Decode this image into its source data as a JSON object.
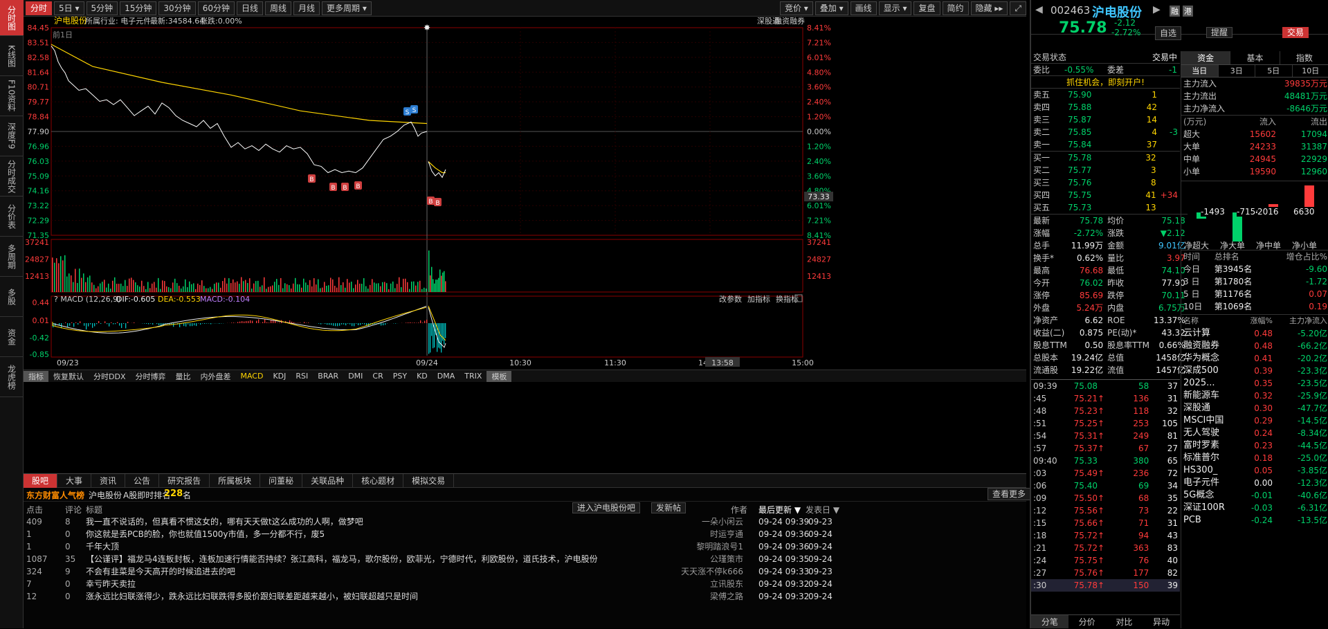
{
  "left_nav": [
    "分时图",
    "K线图",
    "F10资料",
    "深度F9",
    "分时成交",
    "分价表",
    "多周期",
    "多股",
    "资金",
    "龙虎榜"
  ],
  "periods": [
    "分时",
    "5日",
    "5分钟",
    "15分钟",
    "30分钟",
    "60分钟",
    "日线",
    "周线",
    "月线",
    "更多周期"
  ],
  "toolbar_right": [
    "竞价",
    "叠加",
    "画线",
    "显示",
    "复盘",
    "简约",
    "隐藏"
  ],
  "chart_header": {
    "name": "沪电股份",
    "industry": "所属行业: 电子元件",
    "latest": "最新:34584.64",
    "change": "涨跌:0.00%",
    "links": [
      "深股通",
      "融资融券"
    ],
    "prev_day": "前1日"
  },
  "price_ticks": [
    "84.45",
    "83.51",
    "82.58",
    "81.64",
    "80.71",
    "79.77",
    "78.84",
    "77.90",
    "76.96",
    "76.03",
    "75.09",
    "74.16",
    "73.22",
    "72.29",
    "71.35"
  ],
  "pct_ticks": [
    "8.41%",
    "7.21%",
    "6.01%",
    "4.80%",
    "3.60%",
    "2.40%",
    "1.20%",
    "0.00%",
    "1.20%",
    "2.40%",
    "3.60%",
    "4.80%",
    "6.01%",
    "7.21%",
    "8.41%"
  ],
  "cursor_price": "73.33",
  "vol_ticks": [
    "37241",
    "24827",
    "12413"
  ],
  "macd": {
    "label": "MACD (12,26,9)",
    "dif": "DIF:-0.605",
    "dea": "DEA:-0.553",
    "macd": "MACD:-0.104",
    "ticks": [
      "0.44",
      "0.01",
      "-0.42",
      "-0.85"
    ],
    "btns": [
      "改参数",
      "加指标",
      "换指标"
    ]
  },
  "time_axis": [
    "09/23",
    "09/24",
    "10:30",
    "11:30",
    "14",
    "13:58",
    "15:00"
  ],
  "indicators": [
    "指标",
    "恢复默认",
    "分时DDX",
    "分时博弈",
    "量比",
    "内外盘差",
    "MACD",
    "KDJ",
    "RSI",
    "BRAR",
    "DMI",
    "CR",
    "PSY",
    "KD",
    "DMA",
    "TRIX",
    "模板"
  ],
  "bottom": {
    "tabs": [
      "股吧",
      "大事",
      "资讯",
      "公告",
      "研究报告",
      "所属板块",
      "问董秘",
      "关联品种",
      "核心题材",
      "模拟交易"
    ],
    "rank_title": "东方财富人气榜",
    "rank_stock": "沪电股份",
    "rank_label": "A股即时排名",
    "rank_num": "228",
    "rank_unit": "名",
    "more": "查看更多",
    "headers": [
      "点击",
      "评论",
      "标题",
      "作者",
      "最后更新",
      "发表日"
    ],
    "enter_btn": "进入沪电股份吧",
    "post_btn": "发新帖",
    "posts": [
      {
        "clicks": "409",
        "comments": "8",
        "title": "我一直不说话的，但真看不惯这女的，哪有天天做t这么成功的人啊，做梦吧",
        "author": "一朵小闲云",
        "updated": "09-24 09:39",
        "date": "09-23"
      },
      {
        "clicks": "1",
        "comments": "0",
        "title": "你这就是丢PCB的脸，你也就值1500y市值，多一分都不行，废5",
        "author": "时运亨通",
        "updated": "09-24 09:36",
        "date": "09-24"
      },
      {
        "clicks": "1",
        "comments": "0",
        "title": "千年大顶",
        "author": "黎明踏浪号1",
        "updated": "09-24 09:36",
        "date": "09-24"
      },
      {
        "clicks": "1087",
        "comments": "35",
        "title": "【公谨评】福龙马4连板封板，连板加速行情能否持续？张江高科，福龙马，歌尔股份，欧菲光，宁德时代，利欧股份，道氏技术，沪电股份",
        "author": "公瑾策市",
        "updated": "09-24 09:35",
        "date": "09-24"
      },
      {
        "clicks": "324",
        "comments": "9",
        "title": "不会有韭菜是今天高开的时候追进去的吧",
        "author": "天天涨不停k666",
        "updated": "09-24 09:33",
        "date": "09-23"
      },
      {
        "clicks": "7",
        "comments": "0",
        "title": "幸亏昨天卖拉",
        "author": "立讯股东",
        "updated": "09-24 09:32",
        "date": "09-24"
      },
      {
        "clicks": "12",
        "comments": "0",
        "title": "涨永远比妇联涨得少，跌永远比妇联跌得多股价跟妇联差距越来越小，被妇联超越只是时间",
        "author": "梁傅之路",
        "updated": "09-24 09:32",
        "date": "09-24"
      }
    ]
  },
  "quote": {
    "code": "002463",
    "name": "沪电股份",
    "icons": [
      "融",
      "港"
    ],
    "price": "75.78",
    "chg": "-2.12",
    "pct": "-2.72%",
    "btns": [
      "自选",
      "提醒",
      "交易"
    ],
    "status_label": "交易状态",
    "status": "交易中",
    "webi_label": "委比",
    "webi": "-0.55%",
    "weicha_label": "委差",
    "weicha": "-1",
    "ad": "抓住机会，即刻开户!",
    "asks": [
      [
        "卖五",
        "75.90",
        "1",
        ""
      ],
      [
        "卖四",
        "75.88",
        "42",
        ""
      ],
      [
        "卖三",
        "75.87",
        "14",
        ""
      ],
      [
        "卖二",
        "75.85",
        "4",
        "-3"
      ],
      [
        "卖一",
        "75.84",
        "37",
        ""
      ]
    ],
    "bids": [
      [
        "买一",
        "75.78",
        "32",
        ""
      ],
      [
        "买二",
        "75.77",
        "3",
        ""
      ],
      [
        "买三",
        "75.76",
        "8",
        ""
      ],
      [
        "买四",
        "75.75",
        "41",
        "+34"
      ],
      [
        "买五",
        "75.73",
        "13",
        ""
      ]
    ],
    "stats": [
      [
        "最新",
        "75.78",
        "均价",
        "75.18"
      ],
      [
        "涨幅",
        "-2.72%",
        "涨跌",
        "▼2.12"
      ],
      [
        "总手",
        "11.99万",
        "金额",
        "9.01亿"
      ],
      [
        "换手*",
        "0.62%",
        "量比",
        "3.97"
      ],
      [
        "最高",
        "76.68",
        "最低",
        "74.10"
      ],
      [
        "今开",
        "76.02",
        "昨收",
        "77.90"
      ],
      [
        "涨停",
        "85.69",
        "跌停",
        "70.11"
      ],
      [
        "外盘",
        "5.24万",
        "内盘",
        "6.75万"
      ],
      [
        "净资产",
        "6.62",
        "ROE",
        "13.37%"
      ],
      [
        "收益(二)",
        "0.875",
        "PE(动)*",
        "43.32"
      ],
      [
        "股息TTM",
        "0.50",
        "股息率TTM",
        "0.66%"
      ],
      [
        "总股本",
        "19.24亿",
        "总值",
        "1458亿"
      ],
      [
        "流通股",
        "19.22亿",
        "流值",
        "1457亿"
      ]
    ],
    "ticks": [
      [
        "09:39",
        "75.08",
        "58",
        "37",
        "g"
      ],
      [
        ":45",
        "75.21",
        "136",
        "31",
        "r"
      ],
      [
        ":48",
        "75.23",
        "118",
        "32",
        "r"
      ],
      [
        ":51",
        "75.25",
        "253",
        "105",
        "r"
      ],
      [
        ":54",
        "75.31",
        "249",
        "81",
        "r"
      ],
      [
        ":57",
        "75.37",
        "67",
        "27",
        "r"
      ],
      [
        "09:40",
        "75.33",
        "380",
        "65",
        "g"
      ],
      [
        ":03",
        "75.49",
        "236",
        "72",
        "r"
      ],
      [
        ":06",
        "75.40",
        "69",
        "34",
        "g"
      ],
      [
        ":09",
        "75.50",
        "68",
        "35",
        "r"
      ],
      [
        ":12",
        "75.56",
        "73",
        "22",
        "r"
      ],
      [
        ":15",
        "75.66",
        "71",
        "31",
        "r"
      ],
      [
        ":18",
        "75.72",
        "94",
        "43",
        "r"
      ],
      [
        ":21",
        "75.72",
        "363",
        "83",
        "r"
      ],
      [
        ":24",
        "75.75",
        "76",
        "40",
        "r"
      ],
      [
        ":27",
        "75.76",
        "177",
        "82",
        "r"
      ],
      [
        ":30",
        "75.78",
        "150",
        "39",
        "r"
      ]
    ],
    "bottom_tabs": [
      "分笔",
      "分价",
      "对比",
      "异动"
    ]
  },
  "funds": {
    "tabs": [
      "资金",
      "基本",
      "指数"
    ],
    "periods": [
      "当日",
      "3日",
      "5日",
      "10日"
    ],
    "flows": [
      [
        "主力流入",
        "39835万元",
        "r"
      ],
      [
        "主力流出",
        "48481万元",
        "g"
      ],
      [
        "主力净流入",
        "-8646万元",
        "g"
      ]
    ],
    "unit": "(万元)",
    "in_label": "流入",
    "out_label": "流出",
    "sizes": [
      [
        "超大",
        "15602",
        "17094"
      ],
      [
        "大单",
        "24233",
        "31387"
      ],
      [
        "中单",
        "24945",
        "22929"
      ],
      [
        "小单",
        "19590",
        "12960"
      ]
    ],
    "bars": [
      {
        "label": "净超大",
        "value": -1493
      },
      {
        "label": "净大单",
        "value": -7154
      },
      {
        "label": "净中单",
        "value": 2016
      },
      {
        "label": "净小单",
        "value": 6630
      }
    ],
    "rank_head": [
      "时间",
      "总排名",
      "增仓占比%"
    ],
    "ranks": [
      [
        "今日",
        "第3945名",
        "-9.60",
        "g"
      ],
      [
        "3 日",
        "第1780名",
        "-1.72",
        "g"
      ],
      [
        "5 日",
        "第1176名",
        "0.07",
        "r"
      ],
      [
        "10日",
        "第1069名",
        "0.19",
        "r"
      ]
    ],
    "sector_head": [
      "名称",
      "涨幅%",
      "主力净流入"
    ],
    "sectors": [
      [
        "云计算",
        "0.48",
        "-5.20亿"
      ],
      [
        "融资融券",
        "0.48",
        "-66.2亿"
      ],
      [
        "华为概念",
        "0.41",
        "-20.2亿"
      ],
      [
        "深成500",
        "0.39",
        "-23.3亿"
      ],
      [
        "2025...",
        "0.35",
        "-23.5亿"
      ],
      [
        "新能源车",
        "0.32",
        "-25.9亿"
      ],
      [
        "深股通",
        "0.30",
        "-47.7亿"
      ],
      [
        "MSCI中国",
        "0.29",
        "-14.5亿"
      ],
      [
        "无人驾驶",
        "0.24",
        "-8.34亿"
      ],
      [
        "富时罗素",
        "0.23",
        "-44.5亿"
      ],
      [
        "标准普尔",
        "0.18",
        "-25.0亿"
      ],
      [
        "HS300_",
        "0.05",
        "-3.85亿"
      ],
      [
        "电子元件",
        "0.00",
        "-12.3亿"
      ],
      [
        "5G概念",
        "-0.01",
        "-40.6亿"
      ],
      [
        "深证100R",
        "-0.03",
        "-6.31亿"
      ],
      [
        "PCB",
        "-0.24",
        "-13.5亿"
      ]
    ]
  },
  "colors": {
    "up": "#ff3b3b",
    "down": "#00d26a",
    "price_line": "#ffffff",
    "avg_line": "#ffd500",
    "accent": "#cc3333"
  }
}
